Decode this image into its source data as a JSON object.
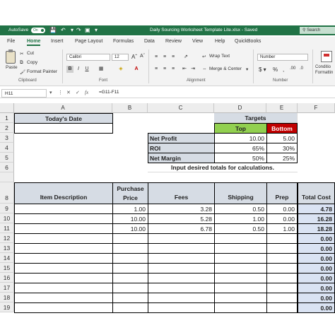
{
  "titlebar": {
    "autosave_label": "AutoSave",
    "autosave_state": "On",
    "doc_title": "Daily Sourcing Worksheet Template Lite.xlsx  -  Saved",
    "search_placeholder": "Search"
  },
  "menu_tabs": [
    "File",
    "Home",
    "Insert",
    "Page Layout",
    "Formulas",
    "Data",
    "Review",
    "View",
    "Help",
    "QuickBooks"
  ],
  "ribbon": {
    "clipboard": {
      "paste": "Paste",
      "cut": "Cut",
      "copy": "Copy",
      "format_painter": "Format Painter",
      "group": "Clipboard"
    },
    "font": {
      "name": "Calibri",
      "size": "12",
      "group": "Font"
    },
    "alignment": {
      "wrap": "Wrap Text",
      "merge": "Merge & Center",
      "group": "Alignment"
    },
    "number": {
      "format": "Number",
      "group": "Number"
    },
    "styles": {
      "conditional": "Conditio",
      "conditional2": "Formattin"
    }
  },
  "formula_bar": {
    "name_box": "H11",
    "formula": "=G11-F11"
  },
  "columns": [
    "A",
    "B",
    "C",
    "D",
    "E",
    "F"
  ],
  "rows": [
    "1",
    "2",
    "3",
    "4",
    "5",
    "6",
    "",
    "8",
    "9",
    "10",
    "11",
    "12",
    "13",
    "14",
    "15",
    "16",
    "17",
    "18",
    "19"
  ],
  "sheet": {
    "todays_date": "Today's Date",
    "targets": "Targets",
    "top": "Top",
    "bottom": "Bottom",
    "metrics": [
      {
        "label": "Net Profit",
        "top": "10.00",
        "bottom": "5.00"
      },
      {
        "label": "ROI",
        "top": "65%",
        "bottom": "30%"
      },
      {
        "label": "Net Margin",
        "top": "50%",
        "bottom": "25%"
      }
    ],
    "instruction": "Input desired totals for calculations.",
    "headers": {
      "item": "Item Description",
      "purchase1": "Purchase",
      "purchase2": "Price",
      "fees": "Fees",
      "shipping": "Shipping",
      "prep": "Prep",
      "total": "Total Cost"
    },
    "items": [
      {
        "price": "1.00",
        "fees": "3.28",
        "shipping": "0.50",
        "prep": "0.00",
        "total": "4.78"
      },
      {
        "price": "10.00",
        "fees": "5.28",
        "shipping": "1.00",
        "prep": "0.00",
        "total": "16.28"
      },
      {
        "price": "10.00",
        "fees": "6.78",
        "shipping": "0.50",
        "prep": "1.00",
        "total": "18.28"
      },
      {
        "price": "",
        "fees": "",
        "shipping": "",
        "prep": "",
        "total": "0.00"
      },
      {
        "price": "",
        "fees": "",
        "shipping": "",
        "prep": "",
        "total": "0.00"
      },
      {
        "price": "",
        "fees": "",
        "shipping": "",
        "prep": "",
        "total": "0.00"
      },
      {
        "price": "",
        "fees": "",
        "shipping": "",
        "prep": "",
        "total": "0.00"
      },
      {
        "price": "",
        "fees": "",
        "shipping": "",
        "prep": "",
        "total": "0.00"
      },
      {
        "price": "",
        "fees": "",
        "shipping": "",
        "prep": "",
        "total": "0.00"
      },
      {
        "price": "",
        "fees": "",
        "shipping": "",
        "prep": "",
        "total": "0.00"
      },
      {
        "price": "",
        "fees": "",
        "shipping": "",
        "prep": "",
        "total": "0.00"
      }
    ]
  }
}
